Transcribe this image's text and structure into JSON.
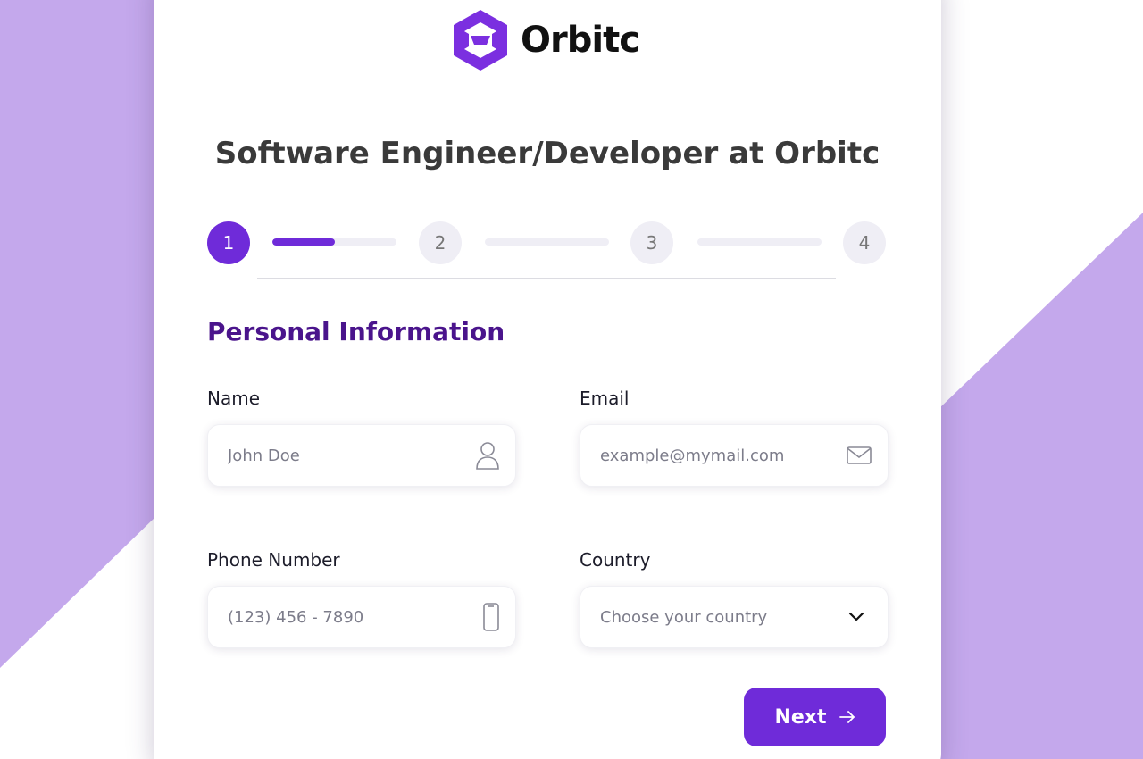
{
  "brand": {
    "name": "Orbitc",
    "color": "#7b2fe0"
  },
  "page": {
    "title": "Software Engineer/Developer at Orbitc"
  },
  "stepper": {
    "steps": [
      "1",
      "2",
      "3",
      "4"
    ],
    "current_step": 1,
    "progress_fractions": [
      0.5,
      0,
      0
    ]
  },
  "section": {
    "title": "Personal Information"
  },
  "form": {
    "name": {
      "label": "Name",
      "placeholder": "John Doe",
      "icon": "user-icon"
    },
    "email": {
      "label": "Email",
      "placeholder": "example@mymail.com",
      "icon": "mail-icon"
    },
    "phone": {
      "label": "Phone Number",
      "placeholder": "(123) 456 - 7890",
      "icon": "phone-icon"
    },
    "country": {
      "label": "Country",
      "placeholder": "Choose your country",
      "icon": "chevron-down-icon"
    }
  },
  "actions": {
    "next_label": "Next",
    "next_icon": "arrow-right-icon"
  },
  "colors": {
    "accent": "#6f2bd9",
    "heading": "#4a148c",
    "background_band": "#c4a8ec"
  }
}
